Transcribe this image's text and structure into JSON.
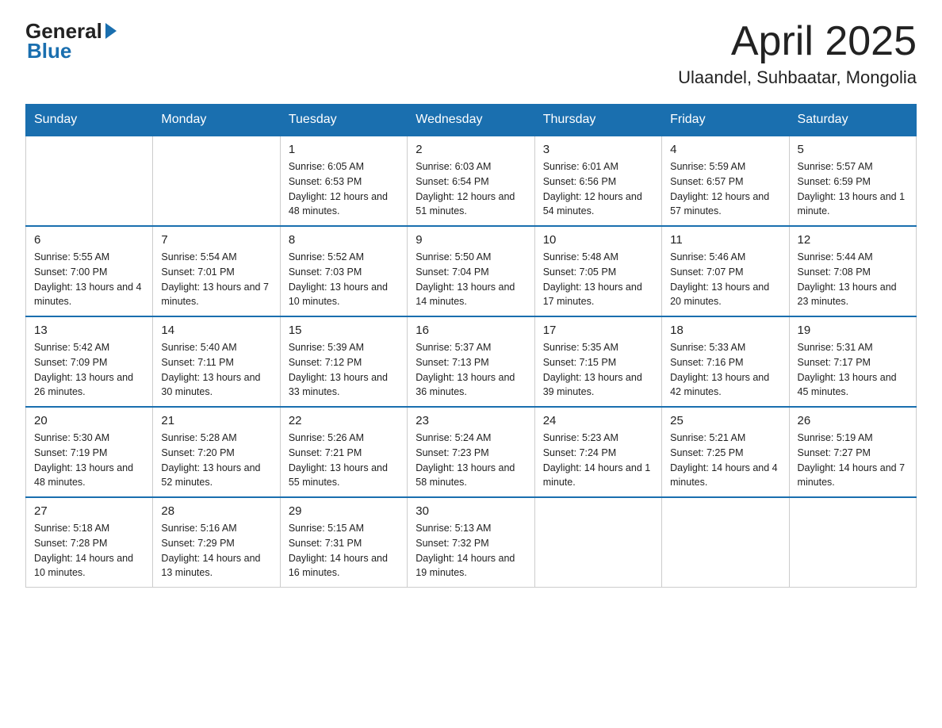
{
  "logo": {
    "general": "General",
    "blue": "Blue"
  },
  "title": "April 2025",
  "location": "Ulaandel, Suhbaatar, Mongolia",
  "weekdays": [
    "Sunday",
    "Monday",
    "Tuesday",
    "Wednesday",
    "Thursday",
    "Friday",
    "Saturday"
  ],
  "weeks": [
    [
      {
        "day": "",
        "sunrise": "",
        "sunset": "",
        "daylight": ""
      },
      {
        "day": "",
        "sunrise": "",
        "sunset": "",
        "daylight": ""
      },
      {
        "day": "1",
        "sunrise": "Sunrise: 6:05 AM",
        "sunset": "Sunset: 6:53 PM",
        "daylight": "Daylight: 12 hours and 48 minutes."
      },
      {
        "day": "2",
        "sunrise": "Sunrise: 6:03 AM",
        "sunset": "Sunset: 6:54 PM",
        "daylight": "Daylight: 12 hours and 51 minutes."
      },
      {
        "day": "3",
        "sunrise": "Sunrise: 6:01 AM",
        "sunset": "Sunset: 6:56 PM",
        "daylight": "Daylight: 12 hours and 54 minutes."
      },
      {
        "day": "4",
        "sunrise": "Sunrise: 5:59 AM",
        "sunset": "Sunset: 6:57 PM",
        "daylight": "Daylight: 12 hours and 57 minutes."
      },
      {
        "day": "5",
        "sunrise": "Sunrise: 5:57 AM",
        "sunset": "Sunset: 6:59 PM",
        "daylight": "Daylight: 13 hours and 1 minute."
      }
    ],
    [
      {
        "day": "6",
        "sunrise": "Sunrise: 5:55 AM",
        "sunset": "Sunset: 7:00 PM",
        "daylight": "Daylight: 13 hours and 4 minutes."
      },
      {
        "day": "7",
        "sunrise": "Sunrise: 5:54 AM",
        "sunset": "Sunset: 7:01 PM",
        "daylight": "Daylight: 13 hours and 7 minutes."
      },
      {
        "day": "8",
        "sunrise": "Sunrise: 5:52 AM",
        "sunset": "Sunset: 7:03 PM",
        "daylight": "Daylight: 13 hours and 10 minutes."
      },
      {
        "day": "9",
        "sunrise": "Sunrise: 5:50 AM",
        "sunset": "Sunset: 7:04 PM",
        "daylight": "Daylight: 13 hours and 14 minutes."
      },
      {
        "day": "10",
        "sunrise": "Sunrise: 5:48 AM",
        "sunset": "Sunset: 7:05 PM",
        "daylight": "Daylight: 13 hours and 17 minutes."
      },
      {
        "day": "11",
        "sunrise": "Sunrise: 5:46 AM",
        "sunset": "Sunset: 7:07 PM",
        "daylight": "Daylight: 13 hours and 20 minutes."
      },
      {
        "day": "12",
        "sunrise": "Sunrise: 5:44 AM",
        "sunset": "Sunset: 7:08 PM",
        "daylight": "Daylight: 13 hours and 23 minutes."
      }
    ],
    [
      {
        "day": "13",
        "sunrise": "Sunrise: 5:42 AM",
        "sunset": "Sunset: 7:09 PM",
        "daylight": "Daylight: 13 hours and 26 minutes."
      },
      {
        "day": "14",
        "sunrise": "Sunrise: 5:40 AM",
        "sunset": "Sunset: 7:11 PM",
        "daylight": "Daylight: 13 hours and 30 minutes."
      },
      {
        "day": "15",
        "sunrise": "Sunrise: 5:39 AM",
        "sunset": "Sunset: 7:12 PM",
        "daylight": "Daylight: 13 hours and 33 minutes."
      },
      {
        "day": "16",
        "sunrise": "Sunrise: 5:37 AM",
        "sunset": "Sunset: 7:13 PM",
        "daylight": "Daylight: 13 hours and 36 minutes."
      },
      {
        "day": "17",
        "sunrise": "Sunrise: 5:35 AM",
        "sunset": "Sunset: 7:15 PM",
        "daylight": "Daylight: 13 hours and 39 minutes."
      },
      {
        "day": "18",
        "sunrise": "Sunrise: 5:33 AM",
        "sunset": "Sunset: 7:16 PM",
        "daylight": "Daylight: 13 hours and 42 minutes."
      },
      {
        "day": "19",
        "sunrise": "Sunrise: 5:31 AM",
        "sunset": "Sunset: 7:17 PM",
        "daylight": "Daylight: 13 hours and 45 minutes."
      }
    ],
    [
      {
        "day": "20",
        "sunrise": "Sunrise: 5:30 AM",
        "sunset": "Sunset: 7:19 PM",
        "daylight": "Daylight: 13 hours and 48 minutes."
      },
      {
        "day": "21",
        "sunrise": "Sunrise: 5:28 AM",
        "sunset": "Sunset: 7:20 PM",
        "daylight": "Daylight: 13 hours and 52 minutes."
      },
      {
        "day": "22",
        "sunrise": "Sunrise: 5:26 AM",
        "sunset": "Sunset: 7:21 PM",
        "daylight": "Daylight: 13 hours and 55 minutes."
      },
      {
        "day": "23",
        "sunrise": "Sunrise: 5:24 AM",
        "sunset": "Sunset: 7:23 PM",
        "daylight": "Daylight: 13 hours and 58 minutes."
      },
      {
        "day": "24",
        "sunrise": "Sunrise: 5:23 AM",
        "sunset": "Sunset: 7:24 PM",
        "daylight": "Daylight: 14 hours and 1 minute."
      },
      {
        "day": "25",
        "sunrise": "Sunrise: 5:21 AM",
        "sunset": "Sunset: 7:25 PM",
        "daylight": "Daylight: 14 hours and 4 minutes."
      },
      {
        "day": "26",
        "sunrise": "Sunrise: 5:19 AM",
        "sunset": "Sunset: 7:27 PM",
        "daylight": "Daylight: 14 hours and 7 minutes."
      }
    ],
    [
      {
        "day": "27",
        "sunrise": "Sunrise: 5:18 AM",
        "sunset": "Sunset: 7:28 PM",
        "daylight": "Daylight: 14 hours and 10 minutes."
      },
      {
        "day": "28",
        "sunrise": "Sunrise: 5:16 AM",
        "sunset": "Sunset: 7:29 PM",
        "daylight": "Daylight: 14 hours and 13 minutes."
      },
      {
        "day": "29",
        "sunrise": "Sunrise: 5:15 AM",
        "sunset": "Sunset: 7:31 PM",
        "daylight": "Daylight: 14 hours and 16 minutes."
      },
      {
        "day": "30",
        "sunrise": "Sunrise: 5:13 AM",
        "sunset": "Sunset: 7:32 PM",
        "daylight": "Daylight: 14 hours and 19 minutes."
      },
      {
        "day": "",
        "sunrise": "",
        "sunset": "",
        "daylight": ""
      },
      {
        "day": "",
        "sunrise": "",
        "sunset": "",
        "daylight": ""
      },
      {
        "day": "",
        "sunrise": "",
        "sunset": "",
        "daylight": ""
      }
    ]
  ]
}
